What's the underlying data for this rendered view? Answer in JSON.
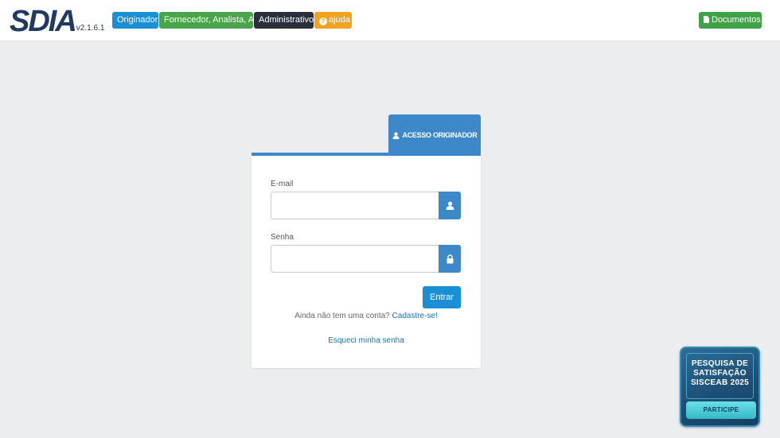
{
  "header": {
    "logo_text": "SDIA",
    "version": "v2.1.6.1",
    "nav": {
      "originador": "Originador",
      "fornecedor": "Fornecedor, Analista, AIS",
      "administrativo": "Administrativo",
      "ajuda": "ajuda"
    },
    "documentos": "Documentos"
  },
  "login": {
    "tab_label": "ACESSO ORIGINADOR",
    "email_label": "E-mail",
    "email_value": "",
    "senha_label": "Senha",
    "senha_value": "",
    "submit_label": "Entrar",
    "no_account_text": "Ainda não tem uma conta?",
    "signup_link": "Cadastre-se!",
    "forgot_link": "Esqueci minha senha"
  },
  "survey": {
    "title": "PESQUISA DE SATISFAÇÃO SISCEAB 2025",
    "button": "PARTICIPE"
  },
  "colors": {
    "primary": "#1b8fd6",
    "accent_blue": "#3d88c8",
    "success": "#4aa54a",
    "dark": "#2b2f3a",
    "warning": "#f2a21d"
  }
}
